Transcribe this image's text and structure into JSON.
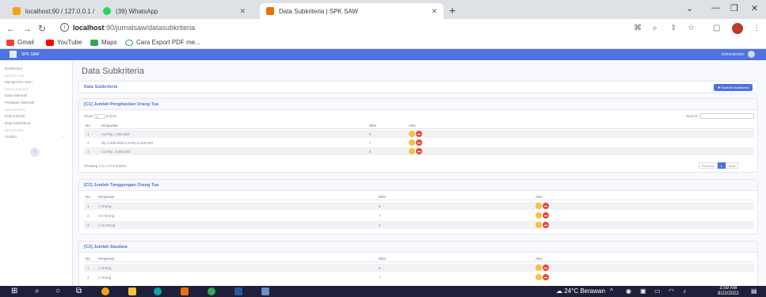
{
  "browser": {
    "tabs": [
      {
        "title": "localhost:90 / 127.0.0.1 / dbsaw /",
        "color": "#f4a21b"
      },
      {
        "title": "(39) WhatsApp",
        "color": "#25d366"
      },
      {
        "title": "Data Subkriteria | SPK SAW",
        "color": "#e8710a"
      }
    ],
    "url_host": "localhost",
    "url_path": ":90/jurnalsaw/datasubkriteria",
    "bookmarks": [
      "Gmail",
      "YouTube",
      "Maps",
      "Cara Export PDF me..."
    ]
  },
  "app": {
    "brand": "SPK SAW",
    "user": "Administrator",
    "sidebar": [
      {
        "type": "item",
        "label": "Dashboard"
      },
      {
        "type": "head",
        "label": "Master Data"
      },
      {
        "type": "item",
        "label": "Manajemen Akun"
      },
      {
        "type": "head",
        "label": "Data Alternatif"
      },
      {
        "type": "item",
        "label": "Data Alternatif"
      },
      {
        "type": "item",
        "label": "Penilaian Alternatif"
      },
      {
        "type": "head",
        "label": "Data Kriteria"
      },
      {
        "type": "item",
        "label": "Data Kriteria"
      },
      {
        "type": "item",
        "label": "Data Subkriteria"
      },
      {
        "type": "head",
        "label": "Metode SAW"
      },
      {
        "type": "item",
        "label": "Analisa"
      }
    ],
    "page_title": "Data Subkriteria",
    "header_card_title": "Data Subkriteria",
    "add_button": "Tambah Subkriteria",
    "show_label": "Show",
    "entries_label": "entries",
    "show_value": "5",
    "search_label": "Search:",
    "showing_text": "Showing 1 to 3 of 3 entries",
    "pager": {
      "prev": "Previous",
      "page": "1",
      "next": "Next"
    },
    "cols": {
      "no": "No.",
      "himpunan": "Himpunan",
      "nilai": "Nilai",
      "aksi": "Aksi"
    },
    "groups": [
      {
        "title": "[C1] Jumlah Penghasilan Orang Tua",
        "rows": [
          {
            "no": "1",
            "himpunan": "C1>Rp.1.000.000",
            "nilai": "9"
          },
          {
            "no": "2",
            "himpunan": "Rp.1.000.000<C1<Rp.3.000.000",
            "nilai": "7"
          },
          {
            "no": "3",
            "himpunan": "C1>Rp. 3.000.000",
            "nilai": "5"
          }
        ]
      },
      {
        "title": "[C2] Jumlah Tanggungan Orang Tua",
        "rows": [
          {
            "no": "1",
            "himpunan": "1 Orang",
            "nilai": "5"
          },
          {
            "no": "2",
            "himpunan": "2-3 Orang",
            "nilai": "7"
          },
          {
            "no": "3",
            "himpunan": ">=5 Orang",
            "nilai": "9"
          }
        ]
      },
      {
        "title": "[C3] Jumlah Saudara",
        "rows": [
          {
            "no": "1",
            "himpunan": "1 Orang",
            "nilai": "5"
          },
          {
            "no": "2",
            "himpunan": "2 Orang",
            "nilai": "7"
          }
        ]
      }
    ]
  },
  "taskbar": {
    "weather": "24°C Berawan",
    "time": "3:59 AM",
    "date": "8/22/2022"
  }
}
